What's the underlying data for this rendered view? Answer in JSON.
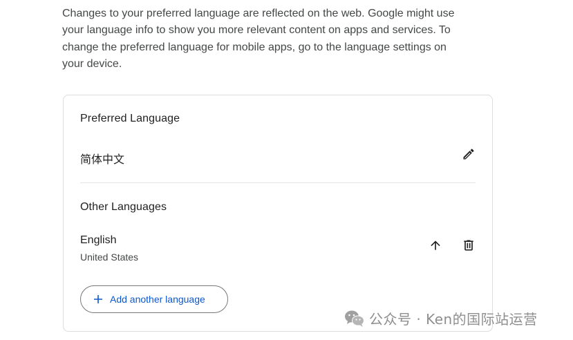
{
  "intro": {
    "text": "Changes to your preferred language are reflected on the web. Google might use your language info to show you more relevant content on apps and services. To change the preferred language for mobile apps, go to the language settings on your device."
  },
  "preferred": {
    "heading": "Preferred Language",
    "language": "简体中文",
    "edit_icon": "pencil-icon"
  },
  "other": {
    "heading": "Other Languages",
    "languages": [
      {
        "name": "English",
        "region": "United States",
        "move_icon": "arrow-up-icon",
        "delete_icon": "trash-icon"
      }
    ],
    "add_button_label": "Add another language",
    "add_icon": "plus-icon"
  },
  "watermark": {
    "text": "公众号 · Ken的国际站运营",
    "icon": "wechat-icon"
  },
  "colors": {
    "accent": "#0b57d0",
    "text": "#1f1f1f",
    "secondary_text": "#444746",
    "border": "#dadce0",
    "watermark": "#8e8e8e"
  }
}
